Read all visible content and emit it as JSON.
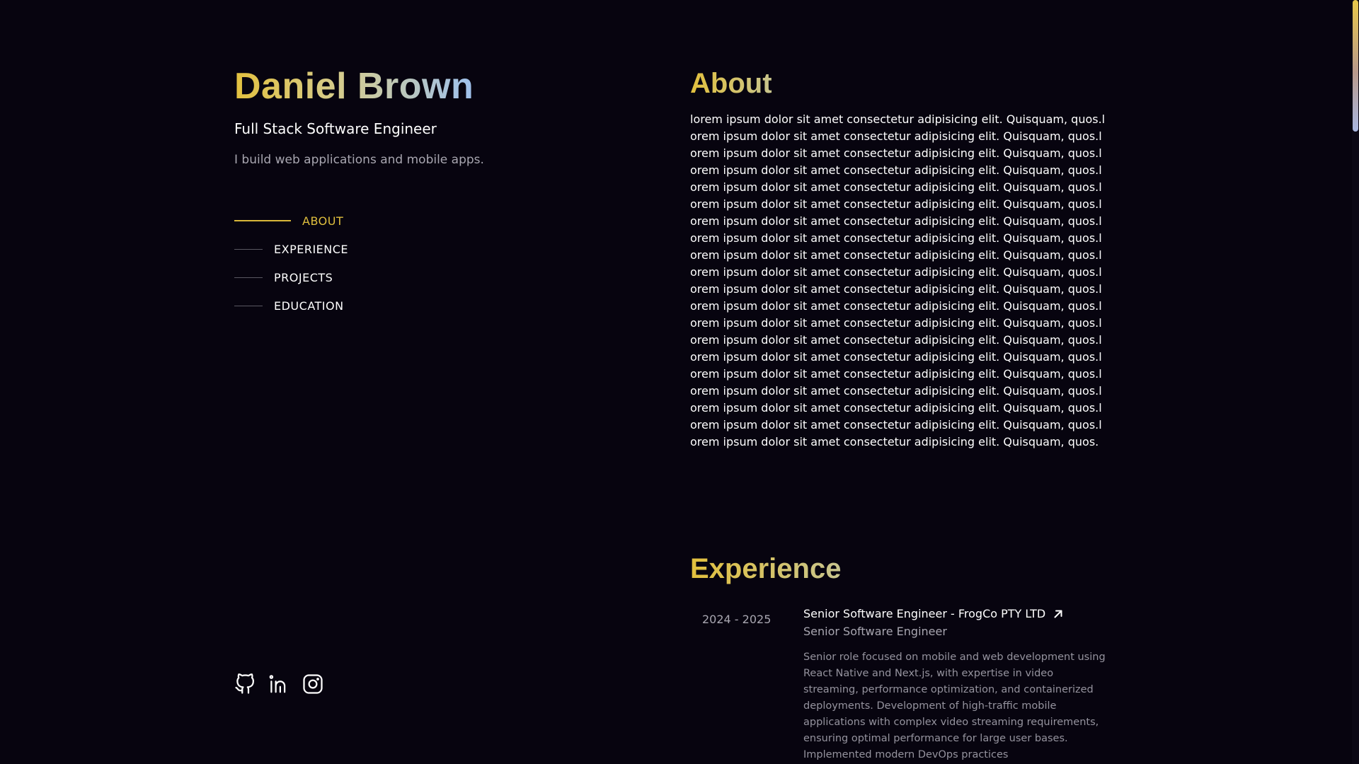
{
  "profile": {
    "name": "Daniel Brown",
    "role": "Full Stack Software Engineer",
    "tagline": "I build web applications and mobile apps."
  },
  "nav": {
    "items": [
      {
        "label": "ABOUT",
        "active": true
      },
      {
        "label": "EXPERIENCE",
        "active": false
      },
      {
        "label": "PROJECTS",
        "active": false
      },
      {
        "label": "EDUCATION",
        "active": false
      }
    ]
  },
  "socials": [
    "github-icon",
    "linkedin-icon",
    "instagram-icon"
  ],
  "colors": {
    "background": "#07040f",
    "accent": "#e0bf3e",
    "accent_blue": "#9fc2ee",
    "muted_text": "#a8a6b0"
  },
  "about": {
    "title": "About",
    "text": "lorem ipsum dolor sit amet consectetur adipisicing elit. Quisquam, quos.lorem ipsum dolor sit amet consectetur adipisicing elit. Quisquam, quos.lorem ipsum dolor sit amet consectetur adipisicing elit. Quisquam, quos.lorem ipsum dolor sit amet consectetur adipisicing elit. Quisquam, quos.lorem ipsum dolor sit amet consectetur adipisicing elit. Quisquam, quos.lorem ipsum dolor sit amet consectetur adipisicing elit. Quisquam, quos.lorem ipsum dolor sit amet consectetur adipisicing elit. Quisquam, quos.lorem ipsum dolor sit amet consectetur adipisicing elit. Quisquam, quos.lorem ipsum dolor sit amet consectetur adipisicing elit. Quisquam, quos.lorem ipsum dolor sit amet consectetur adipisicing elit. Quisquam, quos.lorem ipsum dolor sit amet consectetur adipisicing elit. Quisquam, quos.lorem ipsum dolor sit amet consectetur adipisicing elit. Quisquam, quos.lorem ipsum dolor sit amet consectetur adipisicing elit. Quisquam, quos.lorem ipsum dolor sit amet consectetur adipisicing elit. Quisquam, quos.lorem ipsum dolor sit amet consectetur adipisicing elit. Quisquam, quos.lorem ipsum dolor sit amet consectetur adipisicing elit. Quisquam, quos.lorem ipsum dolor sit amet consectetur adipisicing elit. Quisquam, quos.lorem ipsum dolor sit amet consectetur adipisicing elit. Quisquam, quos.lorem ipsum dolor sit amet consectetur adipisicing elit. Quisquam, quos.lorem ipsum dolor sit amet consectetur adipisicing elit. Quisquam, quos."
  },
  "experience": {
    "title": "Experience",
    "jobs": [
      {
        "period": "2024 - 2025",
        "heading": "Senior Software Engineer - FrogCo PTY LTD",
        "subtitle": "Senior Software Engineer",
        "description": "Senior role focused on mobile and web development using React Native and Next.js, with expertise in video streaming, performance optimization, and containerized deployments. Development of high-traffic mobile applications with complex video streaming requirements, ensuring optimal performance for large user bases. Implemented modern DevOps practices"
      }
    ]
  }
}
